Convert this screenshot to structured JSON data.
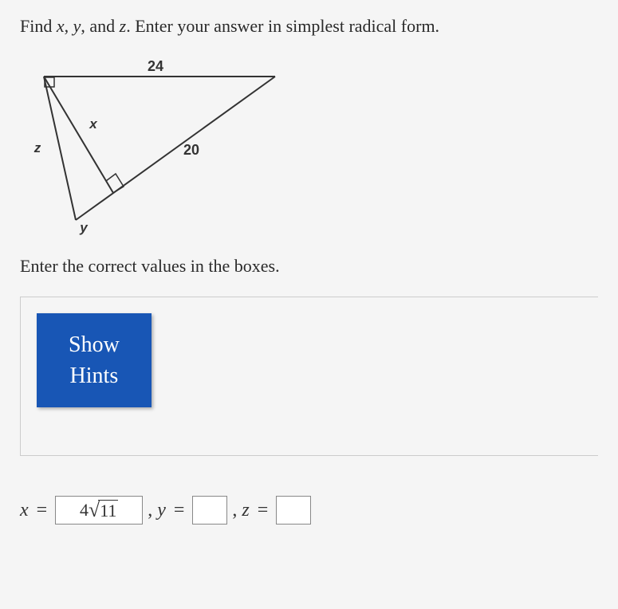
{
  "question": {
    "prefix": "Find ",
    "var1": "x",
    "sep1": ", ",
    "var2": "y",
    "sep2": ", and ",
    "var3": "z",
    "suffix": ". Enter your answer in simplest radical form."
  },
  "diagram": {
    "label_top": "24",
    "label_hyp": "20",
    "label_alt": "x",
    "label_left": "z",
    "label_bottom": "y"
  },
  "instruction": "Enter the correct values in the boxes.",
  "button": {
    "line1": "Show",
    "line2": "Hints"
  },
  "answers": {
    "x_var": "x",
    "x_value_coef": "4",
    "x_value_radicand": "11",
    "y_var": "y",
    "y_value": "",
    "z_var": "z",
    "z_value": "",
    "equals": "=",
    "comma": ","
  }
}
